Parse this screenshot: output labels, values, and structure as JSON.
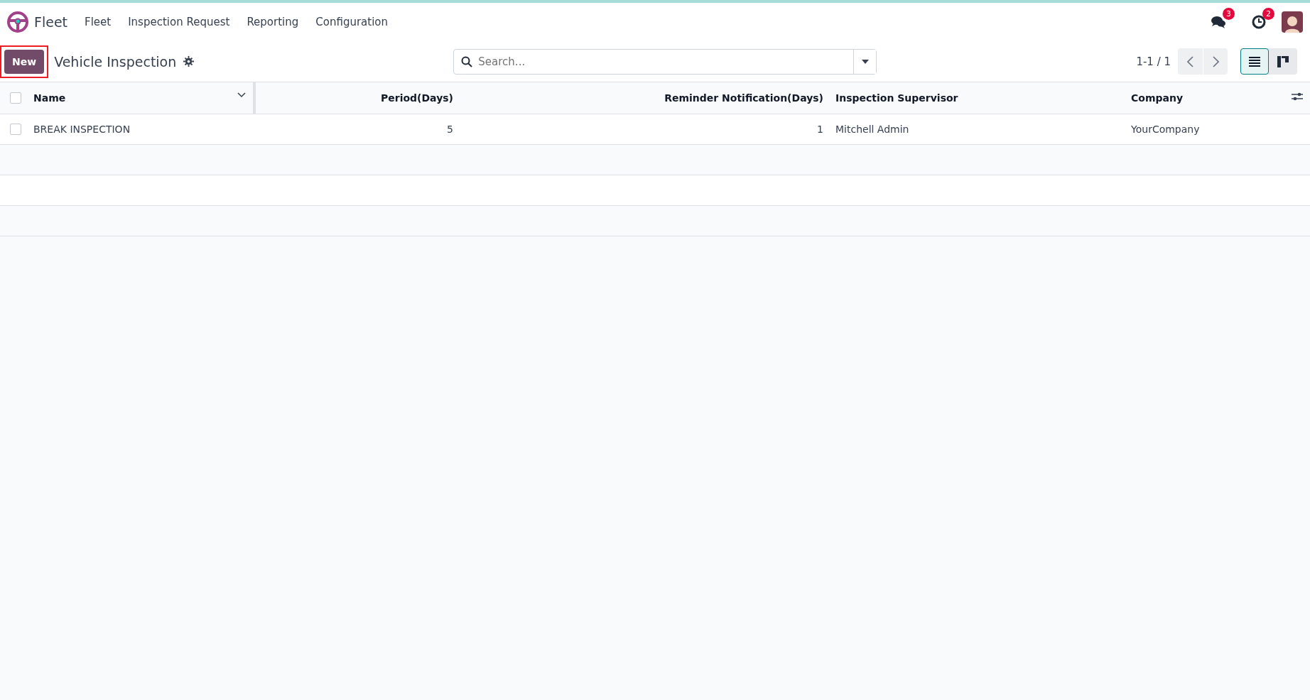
{
  "navbar": {
    "app_name": "Fleet",
    "menu": [
      "Fleet",
      "Inspection Request",
      "Reporting",
      "Configuration"
    ],
    "messages_badge": "3",
    "activities_badge": "2"
  },
  "control_panel": {
    "new_button": {
      "label": "New",
      "highlighted": true
    },
    "title": "Vehicle Inspection",
    "search": {
      "placeholder": "Search..."
    },
    "pager": "1-1 / 1",
    "views": [
      {
        "kind": "list",
        "selected": true
      },
      {
        "kind": "kanban",
        "selected": false
      }
    ]
  },
  "table": {
    "all_selected": false,
    "columns": [
      {
        "label": "Name"
      },
      {
        "label": "Period(Days)"
      },
      {
        "label": "Reminder Notification(Days)"
      },
      {
        "label": "Inspection Supervisor"
      },
      {
        "label": "Company"
      }
    ],
    "rows": [
      {
        "cells": [
          "BREAK INSPECTION",
          "5",
          "1",
          "Mitchell Admin",
          "YourCompany"
        ],
        "checked": false
      }
    ]
  }
}
